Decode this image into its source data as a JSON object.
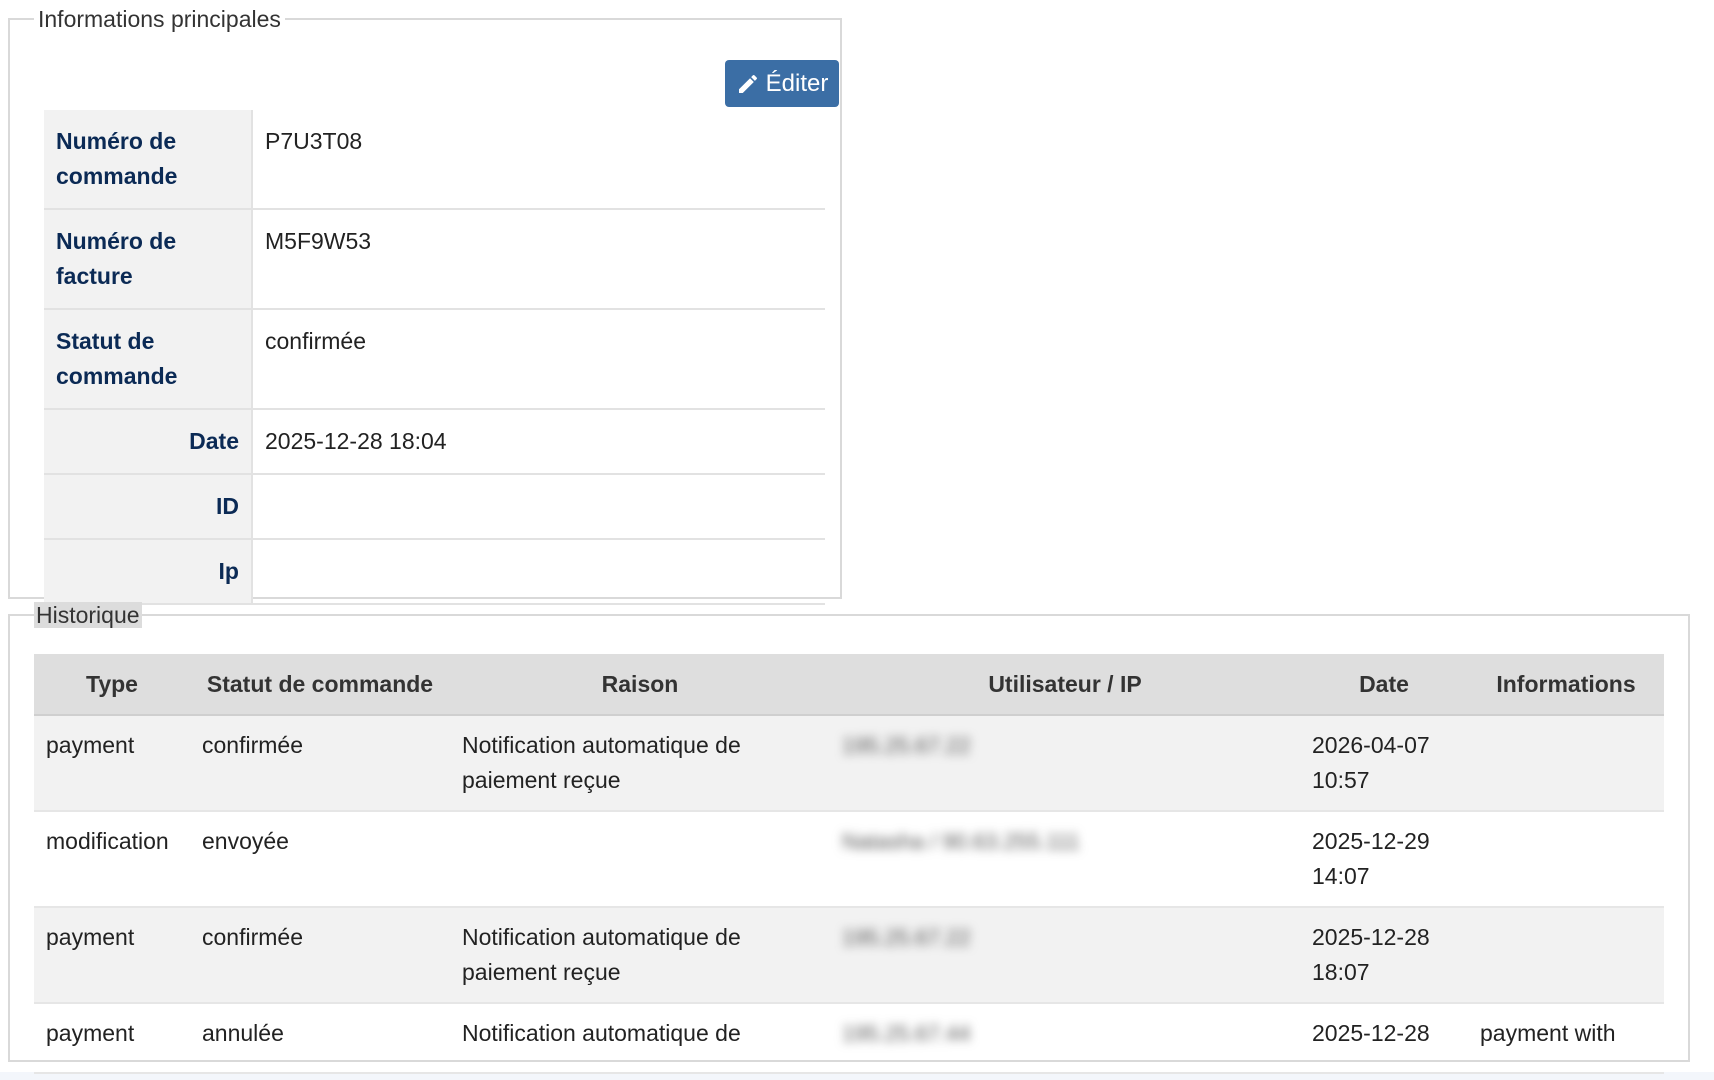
{
  "main": {
    "legend": "Informations principales",
    "edit_button": "Éditer",
    "rows": [
      {
        "label": "Numéro de commande",
        "value": "P7U3T08"
      },
      {
        "label": "Numéro de facture",
        "value": "M5F9W53"
      },
      {
        "label": "Statut de commande",
        "value": "confirmée"
      },
      {
        "label": "Date",
        "value": "2025-12-28 18:04"
      },
      {
        "label": "ID",
        "value": ""
      },
      {
        "label": "Ip",
        "value": ""
      }
    ]
  },
  "history": {
    "legend": "Historique",
    "columns": [
      "Type",
      "Statut de commande",
      "Raison",
      "Utilisateur / IP",
      "Date",
      "Informations"
    ],
    "rows": [
      {
        "type": "payment",
        "status": "confirmée",
        "reason": "Notification automatique de paiement reçue",
        "user_ip": "195.25.67.22",
        "date": "2026-04-07 10:57",
        "info": ""
      },
      {
        "type": "modification",
        "status": "envoyée",
        "reason": "",
        "user_ip": "Natasha / 90.63.255.111",
        "date": "2025-12-29 14:07",
        "info": ""
      },
      {
        "type": "payment",
        "status": "confirmée",
        "reason": "Notification automatique de paiement reçue",
        "user_ip": "195.25.67.22",
        "date": "2025-12-28 18:07",
        "info": ""
      },
      {
        "type": "payment",
        "status": "annulée",
        "reason": "Notification automatique de",
        "user_ip": "195.25.67.44",
        "date": "2025-12-28",
        "info": "payment with"
      }
    ]
  }
}
